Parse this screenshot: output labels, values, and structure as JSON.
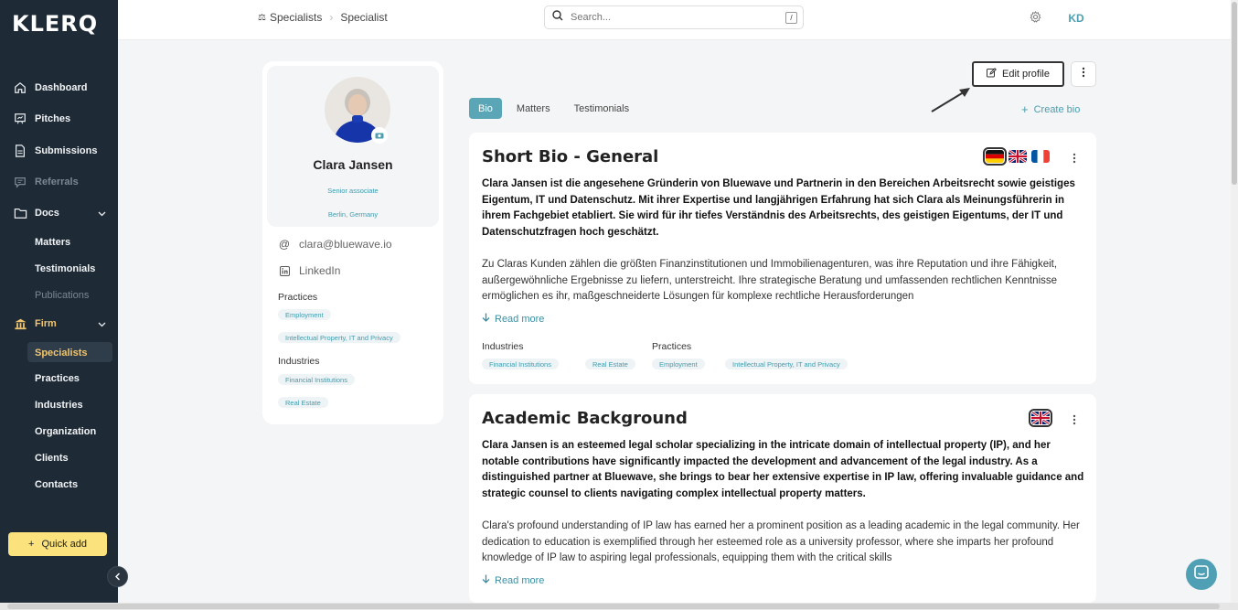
{
  "app": {
    "logo": "KLERQ"
  },
  "sidebar": {
    "items": [
      {
        "label": "Dashboard",
        "icon": "home-icon"
      },
      {
        "label": "Pitches",
        "icon": "presentation-icon"
      },
      {
        "label": "Submissions",
        "icon": "document-icon"
      },
      {
        "label": "Referrals",
        "icon": "chat-icon"
      },
      {
        "label": "Docs",
        "icon": "folder-icon"
      }
    ],
    "docs_sub": [
      "Matters",
      "Testimonials",
      "Publications"
    ],
    "firm": {
      "label": "Firm",
      "icon": "bank-icon"
    },
    "firm_sub": [
      "Specialists",
      "Practices",
      "Industries",
      "Organization",
      "Clients",
      "Contacts"
    ],
    "quick_add": "Quick add"
  },
  "topbar": {
    "breadcrumb": [
      "Specialists",
      "Specialist"
    ],
    "search_placeholder": "Search...",
    "search_shortcut": "/",
    "user_initials": "KD"
  },
  "profile": {
    "name": "Clara Jansen",
    "role": "Senior associate",
    "location": "Berlin, Germany",
    "email": "clara@bluewave.io",
    "linkedin": "LinkedIn",
    "practices_label": "Practices",
    "practices": [
      "Employment",
      "Intellectual Property, IT and Privacy"
    ],
    "industries_label": "Industries",
    "industries": [
      "Financial Institutions",
      "Real Estate"
    ]
  },
  "actions": {
    "edit_profile": "Edit profile",
    "create_bio": "Create bio"
  },
  "tabs": [
    "Bio",
    "Matters",
    "Testimonials"
  ],
  "bios": [
    {
      "title": "Short Bio - General",
      "lead": "Clara Jansen ist die angesehene Gründerin von Bluewave und Partnerin in den Bereichen Arbeitsrecht sowie geistiges Eigentum, IT und Datenschutz. Mit ihrer Expertise und langjährigen Erfahrung hat sich Clara als Meinungsführerin in ihrem Fachgebiet etabliert. Sie wird für ihr tiefes Verständnis des Arbeitsrechts, des geistigen Eigentums, der IT und Datenschutzfragen hoch geschätzt.",
      "body": "Zu Claras Kunden zählen die größten Finanzinstitutionen und Immobilienagenturen, was ihre Reputation und ihre Fähigkeit, außergewöhnliche Ergebnisse zu liefern, unterstreicht. Ihre strategische Beratung und umfassenden rechtlichen Kenntnisse ermöglichen es ihr, maßgeschneiderte Lösungen für komplexe rechtliche Herausforderungen",
      "read_more": "Read more",
      "industries_label": "Industries",
      "industries": [
        "Financial Institutions",
        "Real Estate"
      ],
      "practices_label": "Practices",
      "practices": [
        "Employment",
        "Intellectual Property, IT and Privacy"
      ]
    },
    {
      "title": "Academic Background",
      "lead": "Clara Jansen is an esteemed legal scholar specializing in the intricate domain of intellectual property (IP), and her notable contributions have significantly impacted the development and advancement of the legal industry. As a distinguished partner at Bluewave, she brings to bear her extensive expertise in IP law, offering invaluable guidance and strategic counsel to clients navigating complex intellectual property matters.",
      "body": "Clara's profound understanding of IP law has earned her a prominent position as a leading academic in the legal community. Her dedication to education is exemplified through her esteemed role as a university professor, where she imparts her profound knowledge of IP law to aspiring legal professionals, equipping them with the critical skills",
      "read_more": "Read more"
    }
  ],
  "colors": {
    "sidebar": "#1e2a36",
    "accent": "#5aa6b6",
    "quick_add": "#fbe27c",
    "active_sub": "#f1c66e"
  }
}
